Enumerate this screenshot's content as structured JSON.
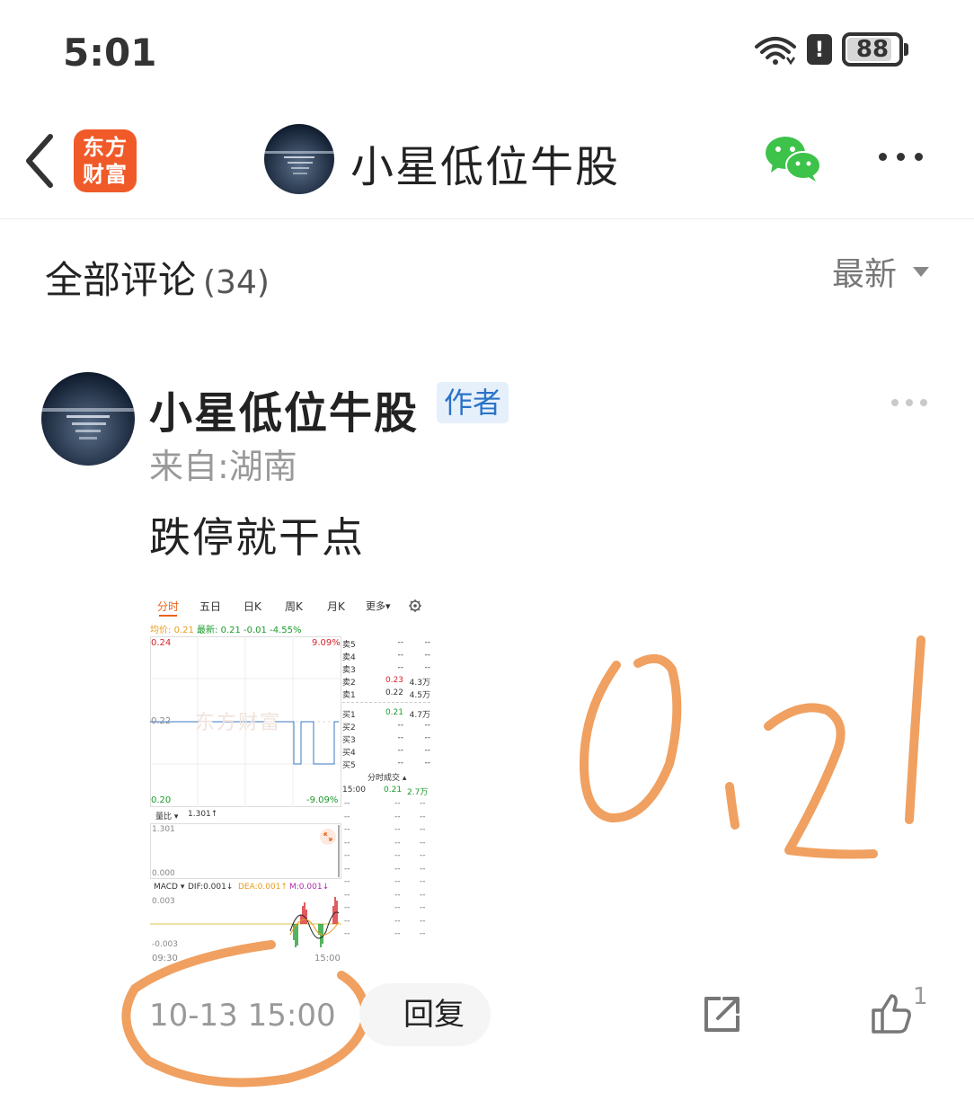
{
  "status_bar": {
    "time": "5:01",
    "battery": "88",
    "battery_fraction": 0.88
  },
  "header": {
    "app_logo_line1": "东方",
    "app_logo_line2": "财富",
    "title": "小星低位牛股"
  },
  "comments": {
    "title": "全部评论",
    "count": "(34)",
    "sort_label": "最新"
  },
  "comment": {
    "author": "小星低位牛股",
    "badge": "作者",
    "location": "来自:湖南",
    "text": "跌停就干点",
    "time": "10-13 15:00",
    "reply_label": "回复",
    "like_count": "1"
  },
  "stock": {
    "tabs": [
      "分时",
      "五日",
      "日K",
      "周K",
      "月K",
      "更多▾"
    ],
    "avg_label": "均价:",
    "avg_value": "0.21",
    "latest_label": "最新:",
    "latest_value": "0.21",
    "change": "-0.01",
    "change_pct": "-4.55%",
    "price_high": "0.24",
    "pct_high": "9.09%",
    "price_mid": "0.22",
    "price_low": "0.20",
    "pct_low": "-9.09%",
    "watermark": "东方财富",
    "orderbook": [
      {
        "k": "卖5",
        "p": "--",
        "v": "--"
      },
      {
        "k": "卖4",
        "p": "--",
        "v": "--"
      },
      {
        "k": "卖3",
        "p": "--",
        "v": "--"
      },
      {
        "k": "卖2",
        "p": "0.23",
        "v": "4.3万"
      },
      {
        "k": "卖1",
        "p": "0.22",
        "v": "4.5万"
      },
      {
        "k": "买1",
        "p": "0.21",
        "v": "4.7万"
      },
      {
        "k": "买2",
        "p": "--",
        "v": "--"
      },
      {
        "k": "买3",
        "p": "--",
        "v": "--"
      },
      {
        "k": "买4",
        "p": "--",
        "v": "--"
      },
      {
        "k": "买5",
        "p": "--",
        "v": "--"
      }
    ],
    "trades_label": "分时成交 ▴",
    "trade_time": "15:00",
    "trade_price": "0.21",
    "trade_vol": "2.7万",
    "vol_ratio_label": "量比 ▾",
    "vol_ratio_value": "1.301↑",
    "vol_top": "1.301",
    "vol_bottom": "0.000",
    "macd_label": "MACD ▾",
    "dif": "DIF:0.001↓",
    "dea": "DEA:0.001↑",
    "m": "M:0.001↓",
    "macd_top": "0.003",
    "macd_bottom": "-0.003",
    "time_start": "09:30",
    "time_end": "15:00",
    "dash": "--"
  },
  "annotation": {
    "handwritten": "0.21"
  },
  "colors": {
    "orange_annotation": "#f0a060",
    "brand": "#f05a28",
    "badge_blue": "#2a73c7"
  }
}
